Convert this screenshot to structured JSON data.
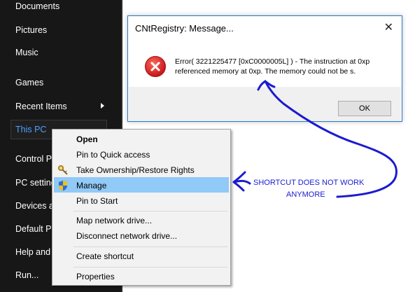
{
  "start_menu": {
    "items": [
      {
        "label": "Documents"
      },
      {
        "label": "Pictures"
      },
      {
        "label": "Music"
      },
      {
        "label": "Games"
      },
      {
        "label": "Recent Items"
      },
      {
        "label": "This PC"
      },
      {
        "label": "Control P"
      },
      {
        "label": "PC setting"
      },
      {
        "label": "Devices ar"
      },
      {
        "label": "Default Pr"
      },
      {
        "label": "Help and"
      },
      {
        "label": "Run..."
      }
    ],
    "active_color": "#4aa3ff"
  },
  "dialog": {
    "title": "CNtRegistry: Message...",
    "close_glyph": "✕",
    "message": "Error( 3221225477 [0xC0000005L] ) - The instruction at 0xp referenced memory at 0xp. The memory could not be s.",
    "ok_label": "OK",
    "icon": "error-icon"
  },
  "context_menu": {
    "items": [
      {
        "label": "Open"
      },
      {
        "label": "Pin to Quick access"
      },
      {
        "label": "Take Ownership/Restore Rights"
      },
      {
        "label": "Manage"
      },
      {
        "label": "Pin to Start"
      },
      {
        "label": "Map network drive..."
      },
      {
        "label": "Disconnect network drive..."
      },
      {
        "label": "Create shortcut"
      },
      {
        "label": "Properties"
      }
    ]
  },
  "annotation": {
    "line1": "SHORTCUT DOES NOT WORK",
    "line2": "ANYMORE",
    "color": "#1b1bd0"
  }
}
